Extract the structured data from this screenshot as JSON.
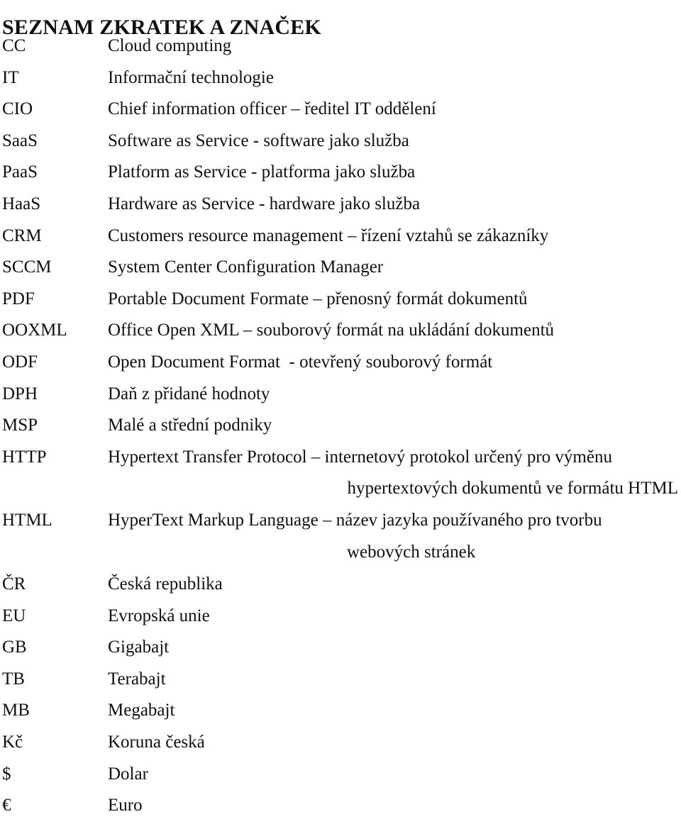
{
  "document": {
    "title": "SEZNAM ZKRATEK A ZNAČEK",
    "language": "cs",
    "page_background": "#ffffff",
    "text_color": "#101010"
  },
  "abbreviations": [
    {
      "term": "CC",
      "definition": "Cloud computing"
    },
    {
      "term": "IT",
      "definition": "Informační technologie"
    },
    {
      "term": "CIO",
      "definition": "Chief information officer – ředitel IT oddělení"
    },
    {
      "term": "SaaS",
      "definition": "Software as Service - software jako služba"
    },
    {
      "term": "PaaS",
      "definition": "Platform as Service - platforma jako služba"
    },
    {
      "term": "HaaS",
      "definition": "Hardware as Service - hardware jako služba"
    },
    {
      "term": "CRM",
      "definition": "Customers resource management – řízení vztahů se zákazníky"
    },
    {
      "term": "SCCM",
      "definition": "System Center Configuration Manager"
    },
    {
      "term": "PDF",
      "definition": "Portable Document Formate – přenosný formát dokumentů"
    },
    {
      "term": "OOXML",
      "definition": "Office Open XML – souborový formát na ukládání dokumentů"
    },
    {
      "term": "ODF",
      "definition": "Open Document Format  - otevřený souborový formát"
    },
    {
      "term": "DPH",
      "definition": "Daň z přidané hodnoty"
    },
    {
      "term": "MSP",
      "definition": "Malé a střední podniky"
    },
    {
      "term": "HTTP",
      "definition": "Hypertext Transfer Protocol – internetový protokol určený pro výměnu",
      "continuation": "hypertextových dokumentů ve formátu HTML"
    },
    {
      "term": "HTML",
      "definition": "HyperText Markup Language – název jazyka používaného pro tvorbu",
      "continuation": "webových stránek"
    },
    {
      "term": "ČR",
      "definition": "Česká republika"
    },
    {
      "term": "EU",
      "definition": "Evropská unie"
    },
    {
      "term": "GB",
      "definition": "Gigabajt"
    },
    {
      "term": "TB",
      "definition": "Terabajt"
    },
    {
      "term": "MB",
      "definition": "Megabajt"
    },
    {
      "term": "Kč",
      "definition": "Koruna česká"
    },
    {
      "term": "$",
      "definition": "Dolar"
    },
    {
      "term": "€",
      "definition": "Euro"
    }
  ]
}
